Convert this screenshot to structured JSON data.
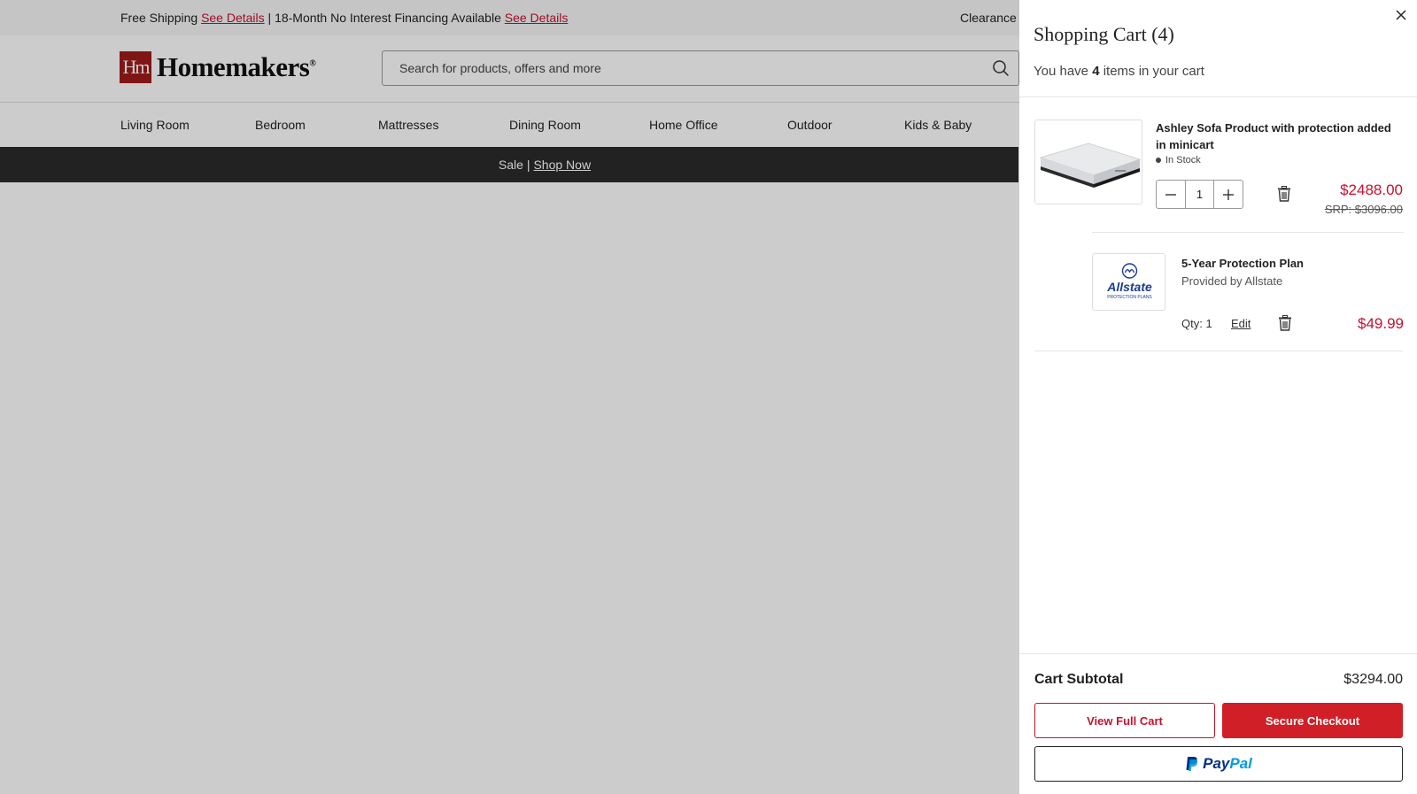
{
  "promo": {
    "free_shipping": "Free Shipping",
    "see_details_1": "See Details",
    "financing": "| 18-Month No Interest Financing Available",
    "see_details_2": "See Details",
    "right_text": "Clearance C"
  },
  "header": {
    "logo_mark": "Hm",
    "logo_text": "Homemakers",
    "search_placeholder": "Search for products, offers and more"
  },
  "nav": {
    "items": [
      "Living Room",
      "Bedroom",
      "Mattresses",
      "Dining Room",
      "Home Office",
      "Outdoor",
      "Kids & Baby"
    ]
  },
  "sale_bar": {
    "text": "Sale |",
    "link": "Shop Now"
  },
  "cart": {
    "title": "Shopping Cart (4)",
    "subtitle_prefix": "You have",
    "count": "4",
    "subtitle_suffix": "items in your cart",
    "item": {
      "title": "Ashley Sofa Product with protection added in minicart",
      "stock": "In Stock",
      "quantity": "1",
      "price": "$2488.00",
      "srp": "SRP: $3096.00"
    },
    "plan": {
      "logo_text": "Allstate",
      "logo_sub": "PROTECTION PLANS",
      "title": "5-Year Protection Plan",
      "provider": "Provided by Allstate",
      "qty": "Qty: 1",
      "edit": "Edit",
      "price": "$49.99"
    },
    "subtotal_label": "Cart Subtotal",
    "subtotal_value": "$3294.00",
    "view_cart": "View Full Cart",
    "checkout": "Secure Checkout",
    "paypal_pay": "Pay",
    "paypal_pal": "Pal"
  },
  "colors": {
    "accent_red": "#c8102e",
    "checkout_red": "#d01f26",
    "sale_bar": "#2b2b2b",
    "paypal_dark": "#003087",
    "paypal_light": "#009cde"
  }
}
